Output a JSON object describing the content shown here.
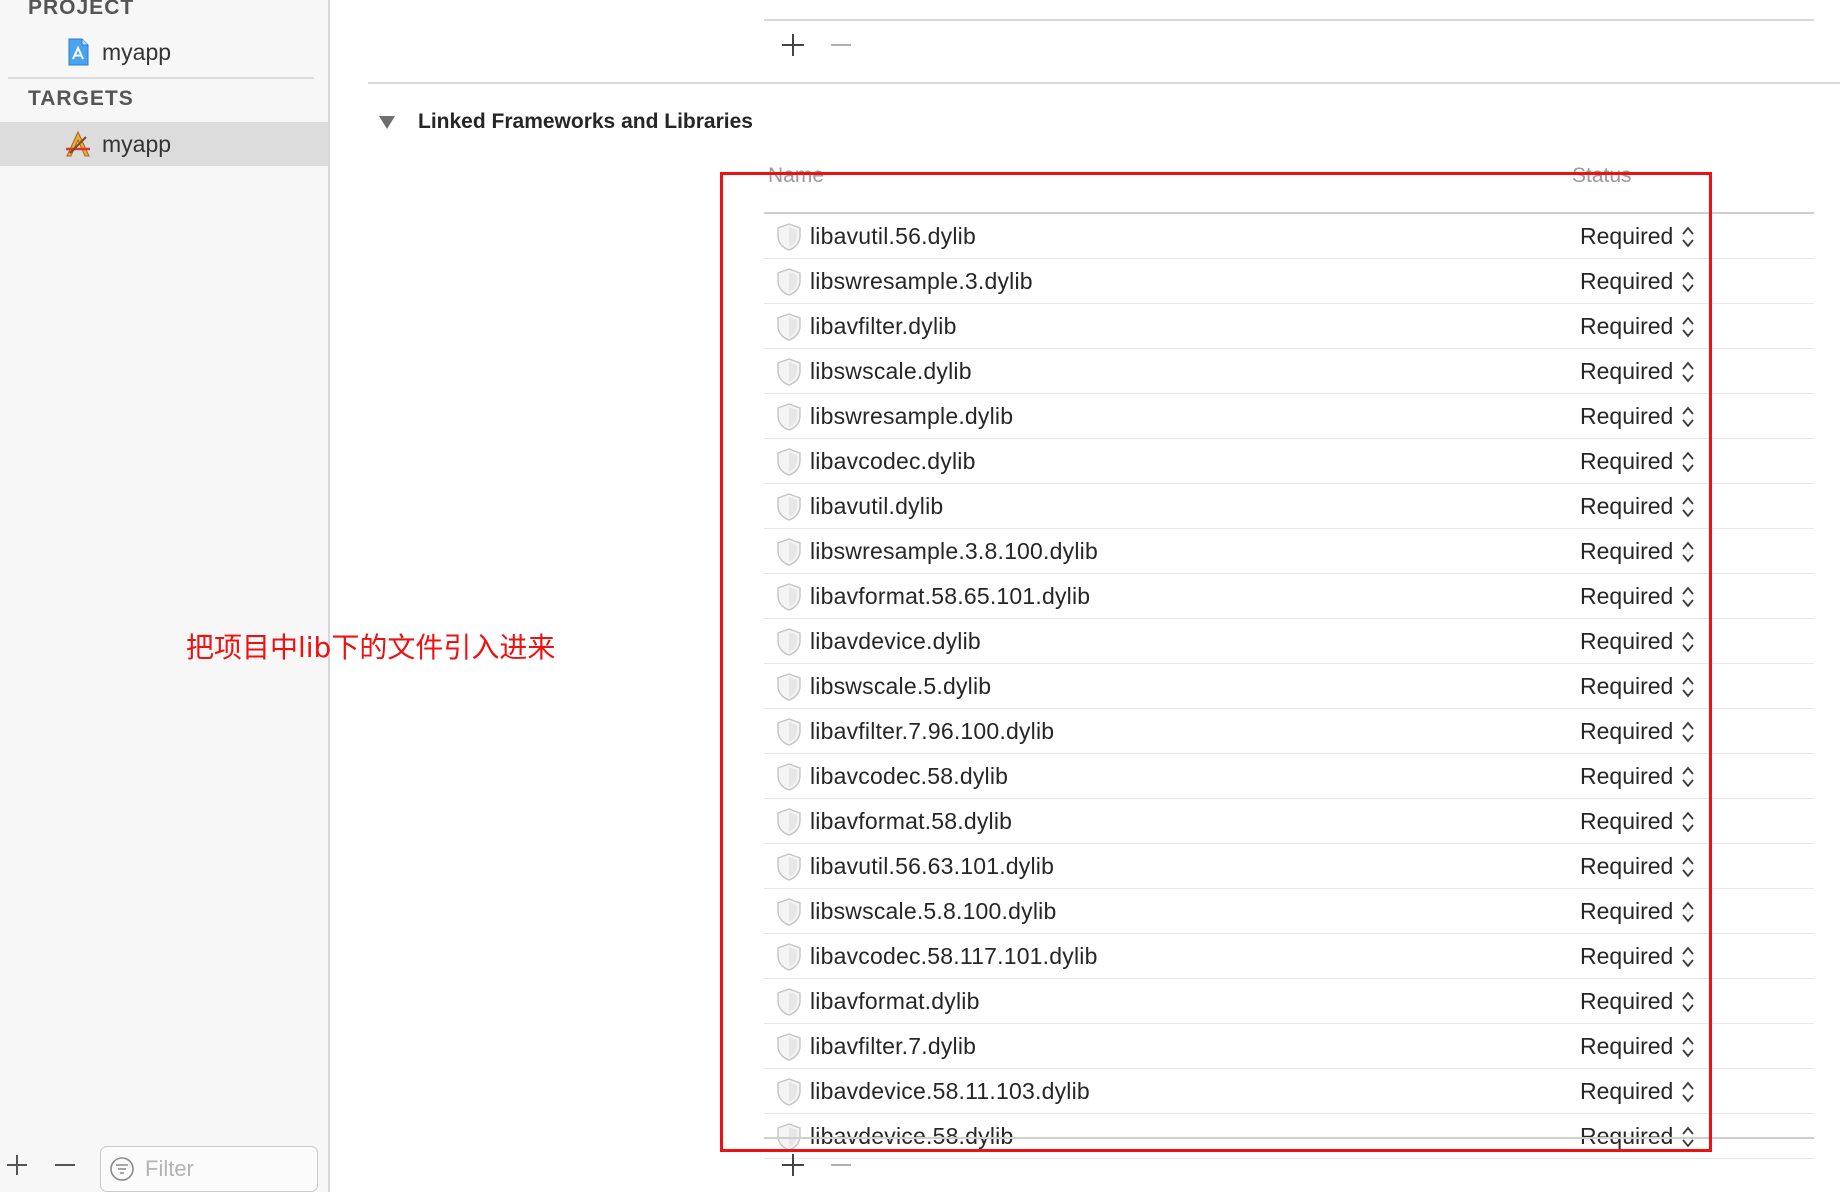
{
  "sidebar": {
    "project_heading": "PROJECT",
    "project_item": "myapp",
    "targets_heading": "TARGETS",
    "target_item": "myapp",
    "filter_placeholder": "Filter"
  },
  "section": {
    "title": "Linked Frameworks and Libraries"
  },
  "table": {
    "columns": {
      "name": "Name",
      "status": "Status"
    },
    "rows": [
      {
        "name": "libavutil.56.dylib",
        "status": "Required"
      },
      {
        "name": "libswresample.3.dylib",
        "status": "Required"
      },
      {
        "name": "libavfilter.dylib",
        "status": "Required"
      },
      {
        "name": "libswscale.dylib",
        "status": "Required"
      },
      {
        "name": "libswresample.dylib",
        "status": "Required"
      },
      {
        "name": "libavcodec.dylib",
        "status": "Required"
      },
      {
        "name": "libavutil.dylib",
        "status": "Required"
      },
      {
        "name": "libswresample.3.8.100.dylib",
        "status": "Required"
      },
      {
        "name": "libavformat.58.65.101.dylib",
        "status": "Required"
      },
      {
        "name": "libavdevice.dylib",
        "status": "Required"
      },
      {
        "name": "libswscale.5.dylib",
        "status": "Required"
      },
      {
        "name": "libavfilter.7.96.100.dylib",
        "status": "Required"
      },
      {
        "name": "libavcodec.58.dylib",
        "status": "Required"
      },
      {
        "name": "libavformat.58.dylib",
        "status": "Required"
      },
      {
        "name": "libavutil.56.63.101.dylib",
        "status": "Required"
      },
      {
        "name": "libswscale.5.8.100.dylib",
        "status": "Required"
      },
      {
        "name": "libavcodec.58.117.101.dylib",
        "status": "Required"
      },
      {
        "name": "libavformat.dylib",
        "status": "Required"
      },
      {
        "name": "libavfilter.7.dylib",
        "status": "Required"
      },
      {
        "name": "libavdevice.58.11.103.dylib",
        "status": "Required"
      },
      {
        "name": "libavdevice.58.dylib",
        "status": "Required"
      }
    ]
  },
  "annotation": {
    "text": "把项目中lib下的文件引入进来",
    "color": "#ee1111"
  },
  "icons": {
    "project": "project-file-icon",
    "target": "app-target-icon",
    "library": "library-shield-icon",
    "stepper": "stepper-icon",
    "add": "plus-icon",
    "remove": "minus-icon",
    "filter": "filter-icon",
    "disclosure": "disclosure-triangle-icon"
  }
}
